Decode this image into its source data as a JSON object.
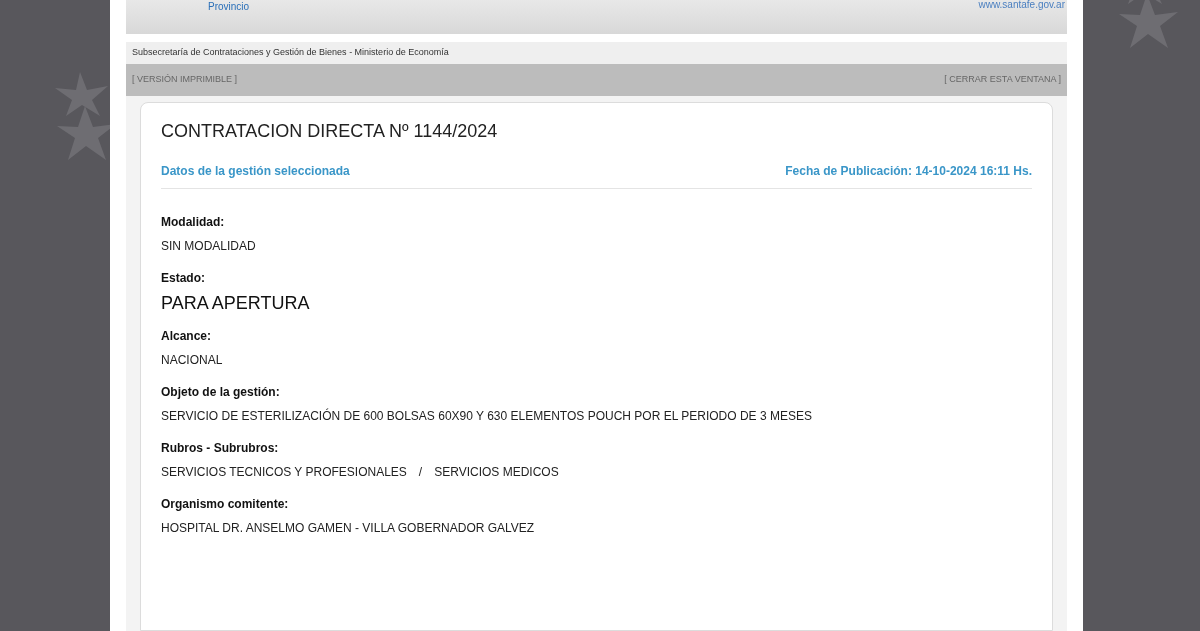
{
  "header": {
    "province_link": "Provincio",
    "site_link": "www.santafe.gov.ar"
  },
  "agency": "Subsecretaría de Contrataciones y Gestión de Bienes - Ministerio de Economía",
  "toolbar": {
    "print_link": "[ VERSIÓN IMPRIMIBLE ]",
    "close_link": "[ CERRAR ESTA VENTANA ]"
  },
  "card": {
    "title": "CONTRATACION DIRECTA Nº 1144/2024",
    "section_label": "Datos de la gestión seleccionada",
    "publication_date": "Fecha de Publicación: 14-10-2024 16:11 Hs.",
    "fields": [
      {
        "label": "Modalidad:",
        "kind": "normal",
        "values": [
          "SIN MODALIDAD"
        ]
      },
      {
        "label": "Estado:",
        "kind": "large",
        "values": [
          "PARA APERTURA"
        ]
      },
      {
        "label": "Alcance:",
        "kind": "normal",
        "values": [
          "NACIONAL"
        ]
      },
      {
        "label": "Objeto de la gestión:",
        "kind": "normal",
        "values": [
          "SERVICIO DE ESTERILIZACIÓN DE 600 BOLSAS 60X90 Y 630 ELEMENTOS POUCH POR EL PERIODO DE 3 MESES"
        ]
      },
      {
        "label": "Rubros - Subrubros:",
        "kind": "normal",
        "values": [
          "SERVICIOS TECNICOS Y PROFESIONALES",
          "/",
          "SERVICIOS MEDICOS"
        ]
      },
      {
        "label": "Organismo comitente:",
        "kind": "normal",
        "values": [
          "HOSPITAL DR. ANSELMO GAMEN - VILLA GOBERNADOR GALVEZ"
        ]
      }
    ]
  }
}
